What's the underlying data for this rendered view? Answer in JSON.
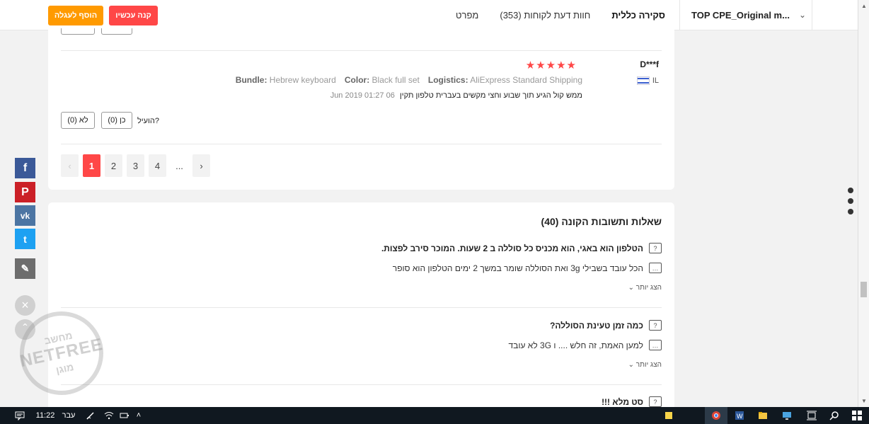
{
  "header": {
    "add_to_cart": "הוסף לעגלה",
    "buy_now": "קנה עכשיו",
    "tabs": [
      {
        "label": "סקירה כללית",
        "active": true
      },
      {
        "label": "חוות דעת לקוחות (353)",
        "active": false
      },
      {
        "label": "מפרט",
        "active": false
      }
    ],
    "product_name": "TOP CPE_Original m...",
    "colors": {
      "cart": "#ff9a00",
      "buy": "#ff4747"
    }
  },
  "review": {
    "reviewer": "D***f",
    "country": "IL",
    "stars": "★★★★★",
    "attributes": [
      {
        "key": "Bundle:",
        "value": "Hebrew keyboard"
      },
      {
        "key": "Color:",
        "value": "Black full set"
      },
      {
        "key": "Logistics:",
        "value": "AliExpress Standard Shipping"
      }
    ],
    "text": "ממש קול הגיע תוך שבוע וחצי מקשים בעברית טלפון תקין",
    "date": "06 Jun 2019 01:27",
    "helpful_label": "הועיל?",
    "yes_label": "כן (0)",
    "no_label": "לא (0)"
  },
  "pagination": {
    "prev": "‹",
    "pages": [
      "1",
      "2",
      "3",
      "4"
    ],
    "dots": "...",
    "next": "›",
    "current": "1"
  },
  "qa": {
    "title": "שאלות ותשובות הקונה (40)",
    "items": [
      {
        "question": "הטלפון הוא באגי, הוא מכניס כל סוללה ב 2 שעות. המוכר סירב לפצות.",
        "answer": "הכל עובד בשבילי 3g ואת הסוללה שומר במשך 2 ימים הטלפון הוא סופר",
        "more": "הצג יותר"
      },
      {
        "question": "כמה זמן טעינת הסוללה?",
        "answer": "למען האמת, זה חלש .... ו 3G לא עובד",
        "more": "הצג יותר"
      },
      {
        "question": "סט מלא !!!"
      }
    ]
  },
  "watermark": {
    "line1": "מחשב",
    "line2": "NETFREE",
    "line3": "מוגן"
  },
  "taskbar": {
    "time": "11:22",
    "lang": "עבר"
  }
}
